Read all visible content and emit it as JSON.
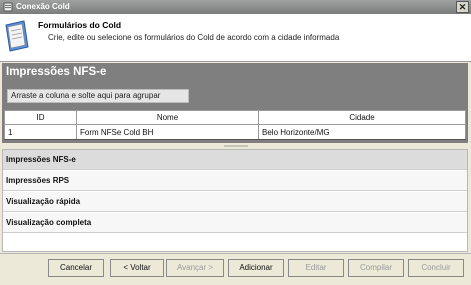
{
  "window": {
    "title": "Conexão Cold",
    "close_label": "✕"
  },
  "header": {
    "title": "Formulários do Cold",
    "subtitle": "Crie, edite ou selecione os formulários do Cold de acordo com a cidade informada"
  },
  "panel": {
    "title": "Impressões NFS-e",
    "group_hint": "Arraste a coluna e solte aqui para agrupar"
  },
  "grid": {
    "columns": [
      "ID",
      "Nome",
      "Cidade"
    ],
    "rows": [
      {
        "id": "1",
        "nome": "Form NFSe Cold BH",
        "cidade": "Belo Horizonte/MG"
      }
    ]
  },
  "nav": {
    "items": [
      "Impressões NFS-e",
      "Impressões RPS",
      "Visualização rápida",
      "Visualização completa"
    ]
  },
  "buttons": {
    "cancel": "Cancelar",
    "back": "< Voltar",
    "next": "Avançar >",
    "add": "Adicionar",
    "edit": "Editar",
    "compile": "Compilar",
    "finish": "Concluir"
  }
}
